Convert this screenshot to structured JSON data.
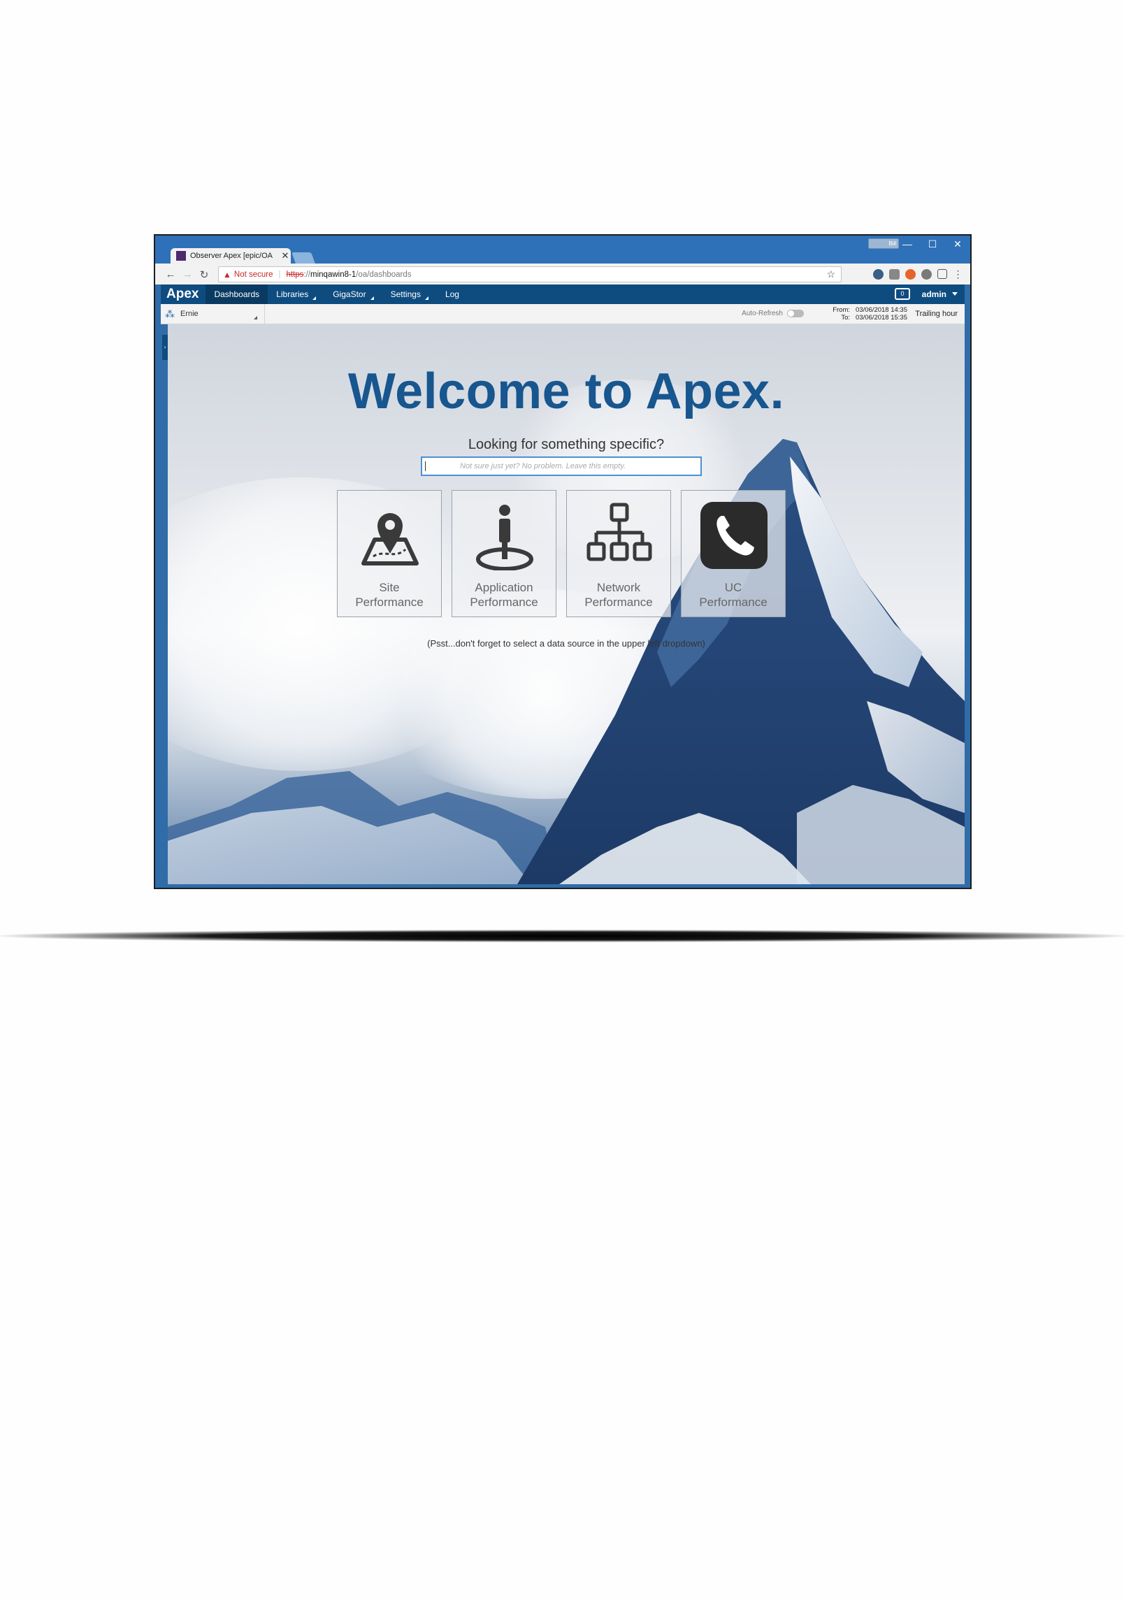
{
  "browser": {
    "tab_title": "Observer Apex [epic/OA",
    "tab_close": "✕",
    "profile_label": "Bill",
    "window_minimize": "—",
    "window_maximize": "☐",
    "window_close": "✕",
    "security_label": "Not secure",
    "url_scheme": "https",
    "url_sep": "://",
    "url_host": "minqawin8-1",
    "url_path": "/oa/dashboards"
  },
  "app": {
    "logo": "Apex",
    "nav": [
      {
        "label": "Dashboards",
        "active": true
      },
      {
        "label": "Libraries",
        "dropdown": true
      },
      {
        "label": "GigaStor",
        "dropdown": true
      },
      {
        "label": "Settings",
        "dropdown": true
      },
      {
        "label": "Log"
      }
    ],
    "briefcase_count": "0",
    "user": "admin"
  },
  "subbar": {
    "data_source": "Ernie",
    "auto_refresh_label": "Auto-Refresh",
    "auto_refresh_on": false,
    "from_label": "From:",
    "from_value": "03/06/2018 14:35",
    "to_label": "To:",
    "to_value": "03/06/2018 15:35",
    "range_preset": "Trailing hour"
  },
  "welcome": {
    "title": "Welcome to Apex.",
    "subtitle": "Looking for something specific?",
    "search_placeholder": "Not sure just yet? No problem. Leave this empty.",
    "tiles": [
      {
        "line1": "Site",
        "line2": "Performance",
        "icon": "map-pin-icon"
      },
      {
        "line1": "Application",
        "line2": "Performance",
        "icon": "person-target-icon"
      },
      {
        "line1": "Network",
        "line2": "Performance",
        "icon": "network-hierarchy-icon"
      },
      {
        "line1": "UC",
        "line2": "Performance",
        "icon": "phone-icon"
      }
    ],
    "hint": "(Psst...don't forget to select a data source in the upper left dropdown)"
  },
  "colors": {
    "app_bar": "#0e4c80",
    "title": "#17568f",
    "titlebar": "#2e71b9"
  }
}
